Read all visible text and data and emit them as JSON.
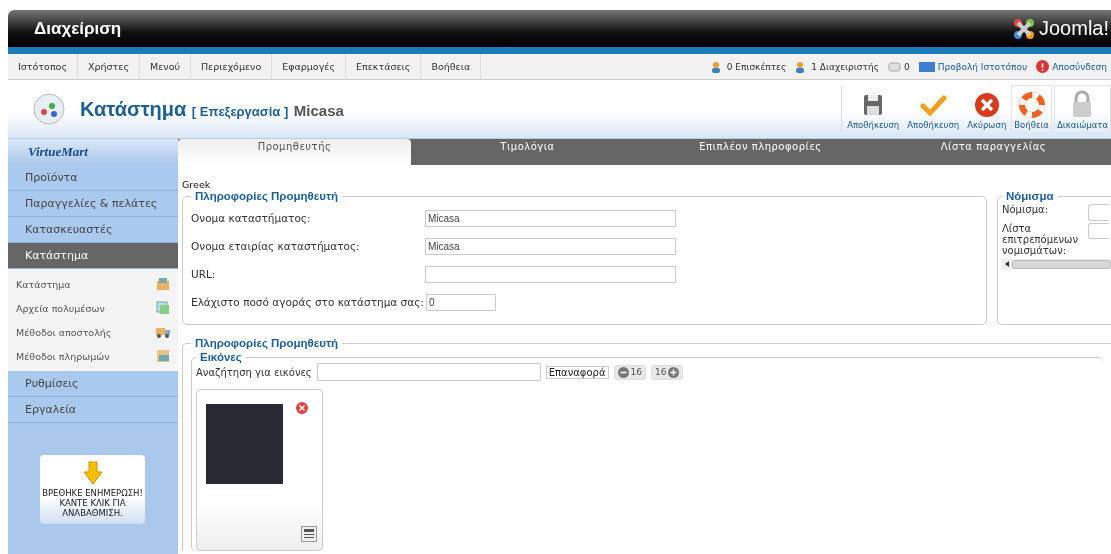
{
  "header": {
    "title": "Διαχείριση",
    "logo_text": "Joomla!"
  },
  "menu": [
    "Ιστότοπος",
    "Χρήστες",
    "Μενού",
    "Περιεχόμενο",
    "Εφαρμογές",
    "Επεκτάσεις",
    "Βοήθεια"
  ],
  "status": [
    {
      "kind": "visitors",
      "text": "0 Επισκέπτες"
    },
    {
      "kind": "admins",
      "text": "1 Διαχειριστής"
    },
    {
      "kind": "messages",
      "text": "0"
    },
    {
      "kind": "view",
      "text": "Προβολή Ιστοτόπου"
    },
    {
      "kind": "logout",
      "text": "Αποσύνδεση"
    }
  ],
  "page_title": {
    "main": "Κατάστημα",
    "action": "[ Επεξεργασία ]",
    "name": "Micasa"
  },
  "toolbar": [
    {
      "kind": "save",
      "label": "Αποθήκευση"
    },
    {
      "kind": "apply",
      "label": "Αποθήκευση"
    },
    {
      "kind": "cancel",
      "label": "Ακύρωση"
    },
    {
      "kind": "help",
      "label": "Βοήθεια"
    },
    {
      "kind": "permissions",
      "label": "Δικαιώματα"
    }
  ],
  "sidebar": {
    "logo": "VirtueMart",
    "sections": [
      {
        "label": "Προϊόντα",
        "selected": false
      },
      {
        "label": "Παραγγελίες & πελάτες",
        "selected": false
      },
      {
        "label": "Κατασκευαστές",
        "selected": false
      },
      {
        "label": "Κατάστημα",
        "selected": true,
        "children": [
          {
            "label": "Κατάστημα",
            "kind": "store",
            "selected": false
          },
          {
            "label": "Αρχεία πολυμέσων",
            "kind": "media",
            "selected": false
          },
          {
            "label": "Μέθοδοι αποστολής",
            "kind": "shipping",
            "selected": false
          },
          {
            "label": "Μέθοδοι πληρωμών",
            "kind": "payment",
            "selected": false
          }
        ]
      },
      {
        "label": "Ρυθμίσεις",
        "selected": false
      },
      {
        "label": "Εργαλεία",
        "selected": false
      }
    ],
    "update_notice": "ΒΡΕΘΗΚΕ ΕΝΗΜΕΡΩΣΗ! ΚΑΝΤΕ ΚΛΙΚ ΓΙΑ ΑΝΑΒΑΘΜΙΣΗ."
  },
  "tabs": [
    {
      "label": "Προμηθευτής",
      "selected": true
    },
    {
      "label": "Τιμολόγια",
      "selected": false
    },
    {
      "label": "Επιπλέον πληροφορίες",
      "selected": false
    },
    {
      "label": "Λίστα παραγγελίας",
      "selected": false
    }
  ],
  "language": "Greek",
  "vendor_info": {
    "legend": "Πληροφορίες Προμηθευτή",
    "fields": [
      {
        "label": "Ονομα καταστήματος:",
        "value": "Micasa",
        "kind": "wide"
      },
      {
        "label": "Ονομα εταιρίας καταστήματος:",
        "value": "Micasa",
        "kind": "wide"
      },
      {
        "label": "URL:",
        "kind": "wide"
      },
      {
        "label": "Ελάχιστο ποσό αγοράς στο κατάστημα σας:",
        "value": "0",
        "kind": "short"
      }
    ]
  },
  "currency": {
    "legend": "Νόμισμα",
    "fields": [
      {
        "label": "Νόμισμα:"
      },
      {
        "label": "Λίστα επιτρεπόμενων νομισμάτων:"
      }
    ]
  },
  "media": {
    "legend": "Πληροφορίες Προμηθευτή",
    "sub_legend": "Εικόνες",
    "search_label": "Αναζήτηση για εικόνες",
    "reset": "Επαναφορά",
    "prev_count": "16",
    "next_count": "16"
  }
}
